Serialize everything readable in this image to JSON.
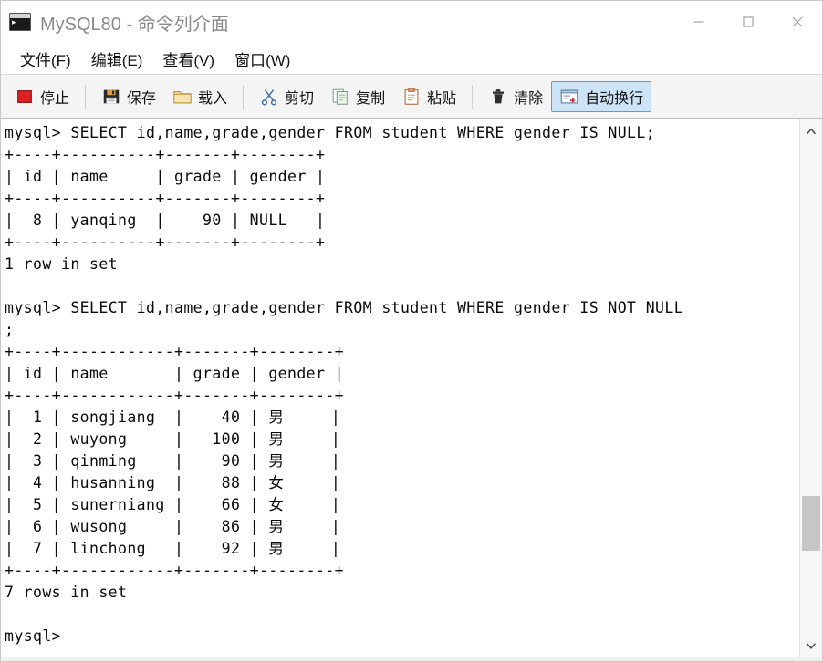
{
  "window": {
    "title": "MySQL80 - 命令列介面",
    "icon": "console-icon",
    "controls": {
      "minimize": "minimize-icon",
      "maximize": "maximize-icon",
      "close": "close-icon"
    }
  },
  "menubar": {
    "items": [
      {
        "label": "文件",
        "accel": "(F)"
      },
      {
        "label": "编辑",
        "accel": "(E)"
      },
      {
        "label": "查看",
        "accel": "(V)"
      },
      {
        "label": "窗口",
        "accel": "(W)"
      }
    ]
  },
  "toolbar": {
    "stop_label": "停止",
    "save_label": "保存",
    "load_label": "载入",
    "cut_label": "剪切",
    "copy_label": "复制",
    "paste_label": "粘贴",
    "clear_label": "清除",
    "wrap_label": "自动换行",
    "wrap_active": true,
    "accent_color": "#cde4f7",
    "accent_border": "#5a9fd4",
    "stop_color": "#e02020"
  },
  "terminal": {
    "prompt": "mysql>",
    "lines": [
      "mysql> SELECT id,name,grade,gender FROM student WHERE gender IS NULL;",
      "+----+----------+-------+--------+",
      "| id | name     | grade | gender |",
      "+----+----------+-------+--------+",
      "|  8 | yanqing  |    90 | NULL   |",
      "+----+----------+-------+--------+",
      "1 row in set",
      "",
      "mysql> SELECT id,name,grade,gender FROM student WHERE gender IS NOT NULL",
      ";",
      "+----+------------+-------+--------+",
      "| id | name       | grade | gender |",
      "+----+------------+-------+--------+",
      "|  1 | songjiang  |    40 | 男     |",
      "|  2 | wuyong     |   100 | 男     |",
      "|  3 | qinming    |    90 | 男     |",
      "|  4 | husanning  |    88 | 女     |",
      "|  5 | sunerniang |    66 | 女     |",
      "|  6 | wusong     |    86 | 男     |",
      "|  7 | linchong   |    92 | 男     |",
      "+----+------------+-------+--------+",
      "7 rows in set",
      "",
      "mysql>"
    ],
    "queries": [
      {
        "sql": "SELECT id,name,grade,gender FROM student WHERE gender IS NULL;",
        "columns": [
          "id",
          "name",
          "grade",
          "gender"
        ],
        "rows": [
          [
            "8",
            "yanqing",
            "90",
            "NULL"
          ]
        ],
        "result_text": "1 row in set"
      },
      {
        "sql": "SELECT id,name,grade,gender FROM student WHERE gender IS NOT NULL;",
        "columns": [
          "id",
          "name",
          "grade",
          "gender"
        ],
        "rows": [
          [
            "1",
            "songjiang",
            "40",
            "男"
          ],
          [
            "2",
            "wuyong",
            "100",
            "男"
          ],
          [
            "3",
            "qinming",
            "90",
            "男"
          ],
          [
            "4",
            "husanning",
            "88",
            "女"
          ],
          [
            "5",
            "sunerniang",
            "66",
            "女"
          ],
          [
            "6",
            "wusong",
            "86",
            "男"
          ],
          [
            "7",
            "linchong",
            "92",
            "男"
          ]
        ],
        "result_text": "7 rows in set"
      }
    ]
  },
  "scrollbar": {
    "up_icon": "chevron-up-icon",
    "down_icon": "chevron-down-icon"
  }
}
